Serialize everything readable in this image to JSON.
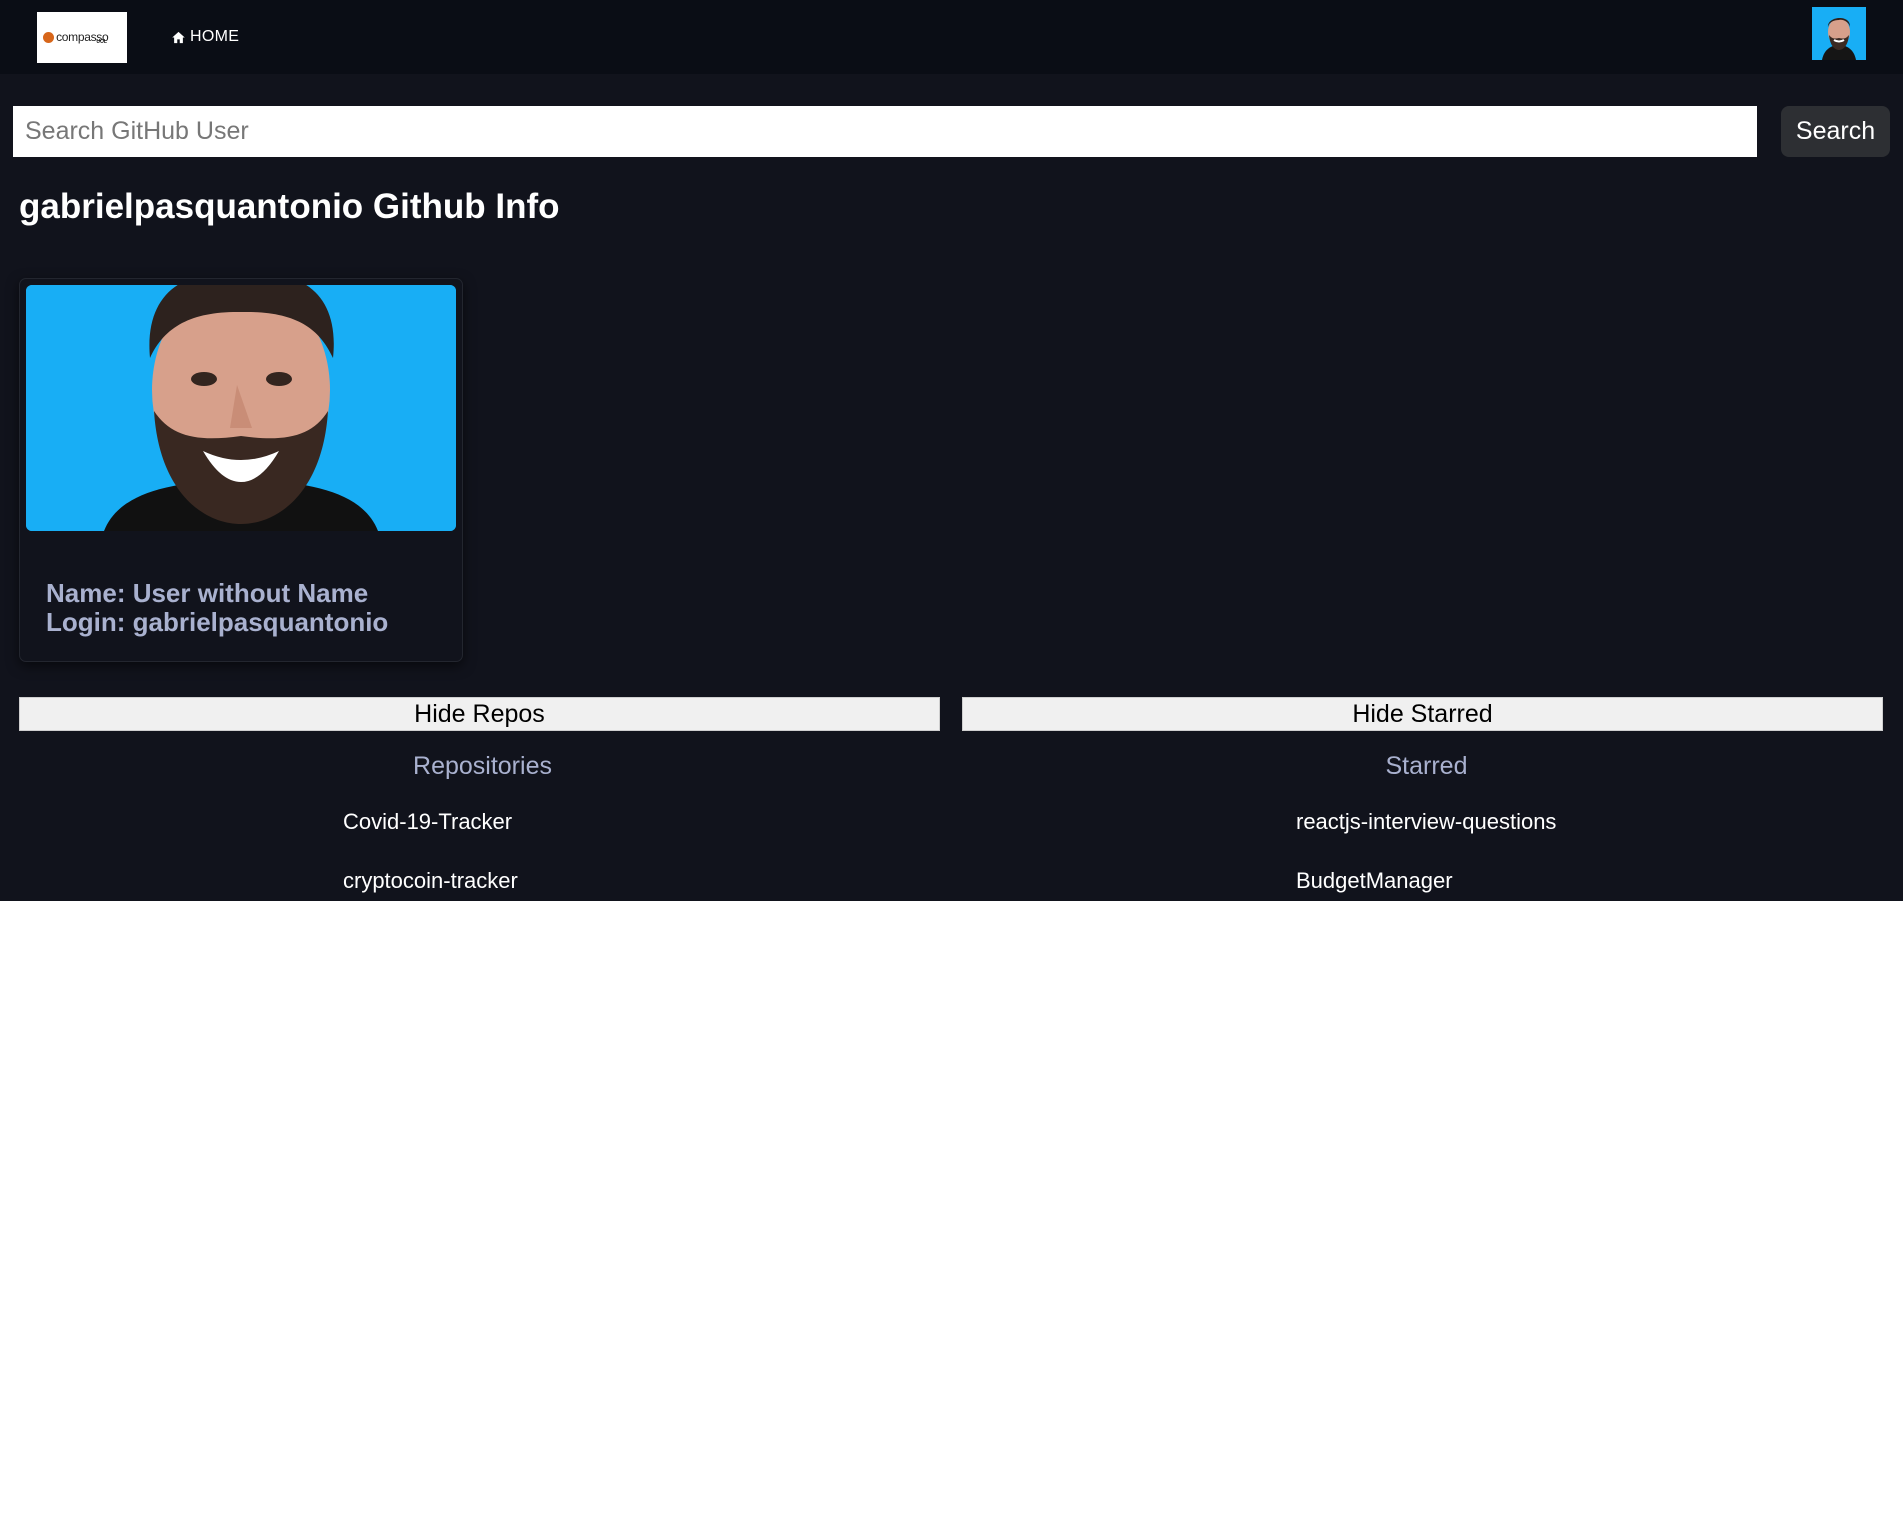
{
  "navbar": {
    "logo_text": "compasso",
    "logo_subtext": "UOL",
    "home_label": "HOME"
  },
  "search": {
    "placeholder": "Search GitHub User",
    "value": "",
    "button_label": "Search"
  },
  "page_title": "gabrielpasquantonio Github Info",
  "user_card": {
    "name_line": "Name: User without Name",
    "login_line": "Login: gabrielpasquantonio"
  },
  "toggles": {
    "repos_label": "Hide Repos",
    "starred_label": "Hide Starred"
  },
  "repositories": {
    "heading": "Repositories",
    "items": [
      "Covid-19-Tracker",
      "cryptocoin-tracker"
    ]
  },
  "starred": {
    "heading": "Starred",
    "items": [
      "reactjs-interview-questions",
      "BudgetManager"
    ]
  },
  "colors": {
    "nav_background": "#0a0d15",
    "page_background": "#11131c",
    "avatar_background": "#18aef5",
    "muted_text": "#a9b1cf"
  }
}
